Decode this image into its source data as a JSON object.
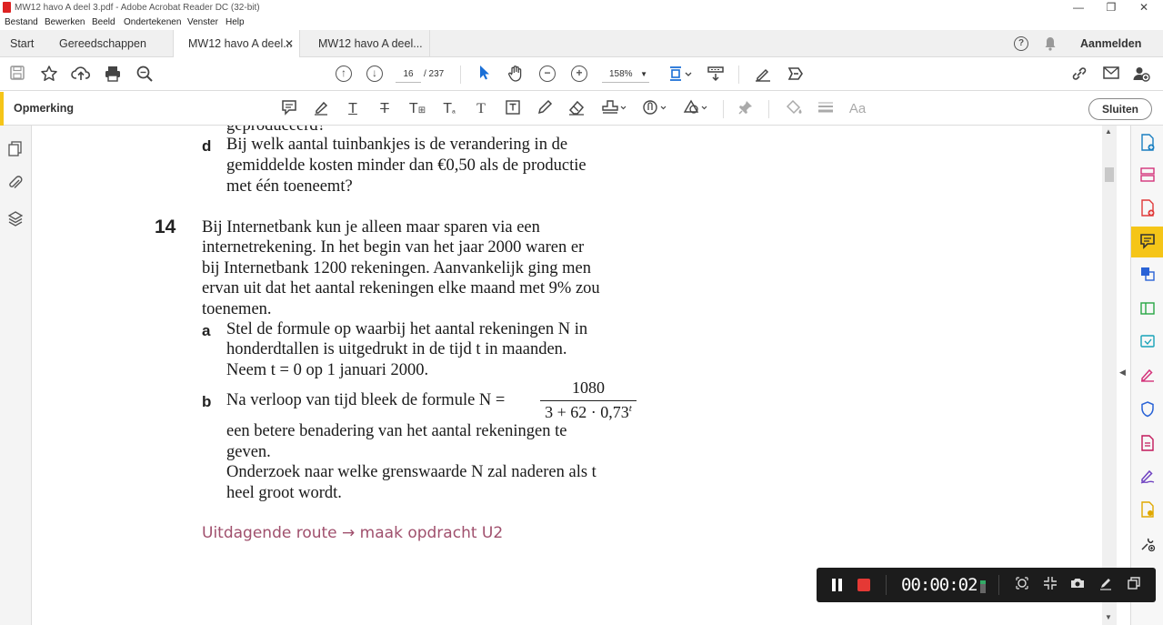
{
  "window": {
    "title": "MW12 havo A deel 3.pdf - Adobe Acrobat Reader DC (32-bit)",
    "minimize": "—",
    "restore": "❐",
    "close": "✕"
  },
  "menu": [
    "Bestand",
    "Bewerken",
    "Beeld",
    "Ondertekenen",
    "Venster",
    "Help"
  ],
  "tabs": {
    "home": "Start",
    "tools": "Gereedschappen",
    "doc1": "MW12 havo A deel...",
    "doc1_close": "✕",
    "doc2": "MW12 havo A deel..."
  },
  "header": {
    "help": "?",
    "signin": "Aanmelden"
  },
  "toolbar": {
    "page_current": "16",
    "page_total": "/ 237",
    "zoom": "158%"
  },
  "comment_bar": {
    "label": "Opmerking",
    "close": "Sluiten"
  },
  "document": {
    "prev_line": "geproduceerd?",
    "d_letter": "d",
    "d_lines": [
      "Bij welk aantal tuinbankjes is de verandering in de",
      "gemiddelde kosten minder dan €0,50 als de productie",
      "met één toeneemt?"
    ],
    "q_number": "14",
    "q_lines": [
      "Bij Internetbank kun je alleen maar sparen via een",
      "internetrekening. In het begin van het jaar 2000 waren er",
      "bij Internetbank 1200 rekeningen. Aanvankelijk ging men",
      "ervan uit dat het aantal rekeningen elke maand met 9% zou",
      "toenemen."
    ],
    "a_letter": "a",
    "a_lines": [
      "Stel de formule op waarbij het aantal rekeningen N in",
      "honderdtallen is uitgedrukt in de tijd t in maanden.",
      "Neem t = 0 op 1 januari 2000."
    ],
    "b_letter": "b",
    "b_intro": "Na verloop van tijd bleek de formule N =",
    "b_numerator": "1080",
    "b_denominator": "3 + 62 · 0,73",
    "b_exponent": "t",
    "b_lines": [
      "een betere benadering van het aantal rekeningen te",
      "geven.",
      "Onderzoek naar welke grenswaarde N zal naderen als t",
      "heel groot wordt."
    ],
    "route": "Uitdagende route → maak opdracht U2"
  },
  "recorder": {
    "time": "00:00:02"
  },
  "colors": {
    "accent_yellow": "#f5c518",
    "route_text": "#a0506d",
    "record_red": "#e53935"
  }
}
